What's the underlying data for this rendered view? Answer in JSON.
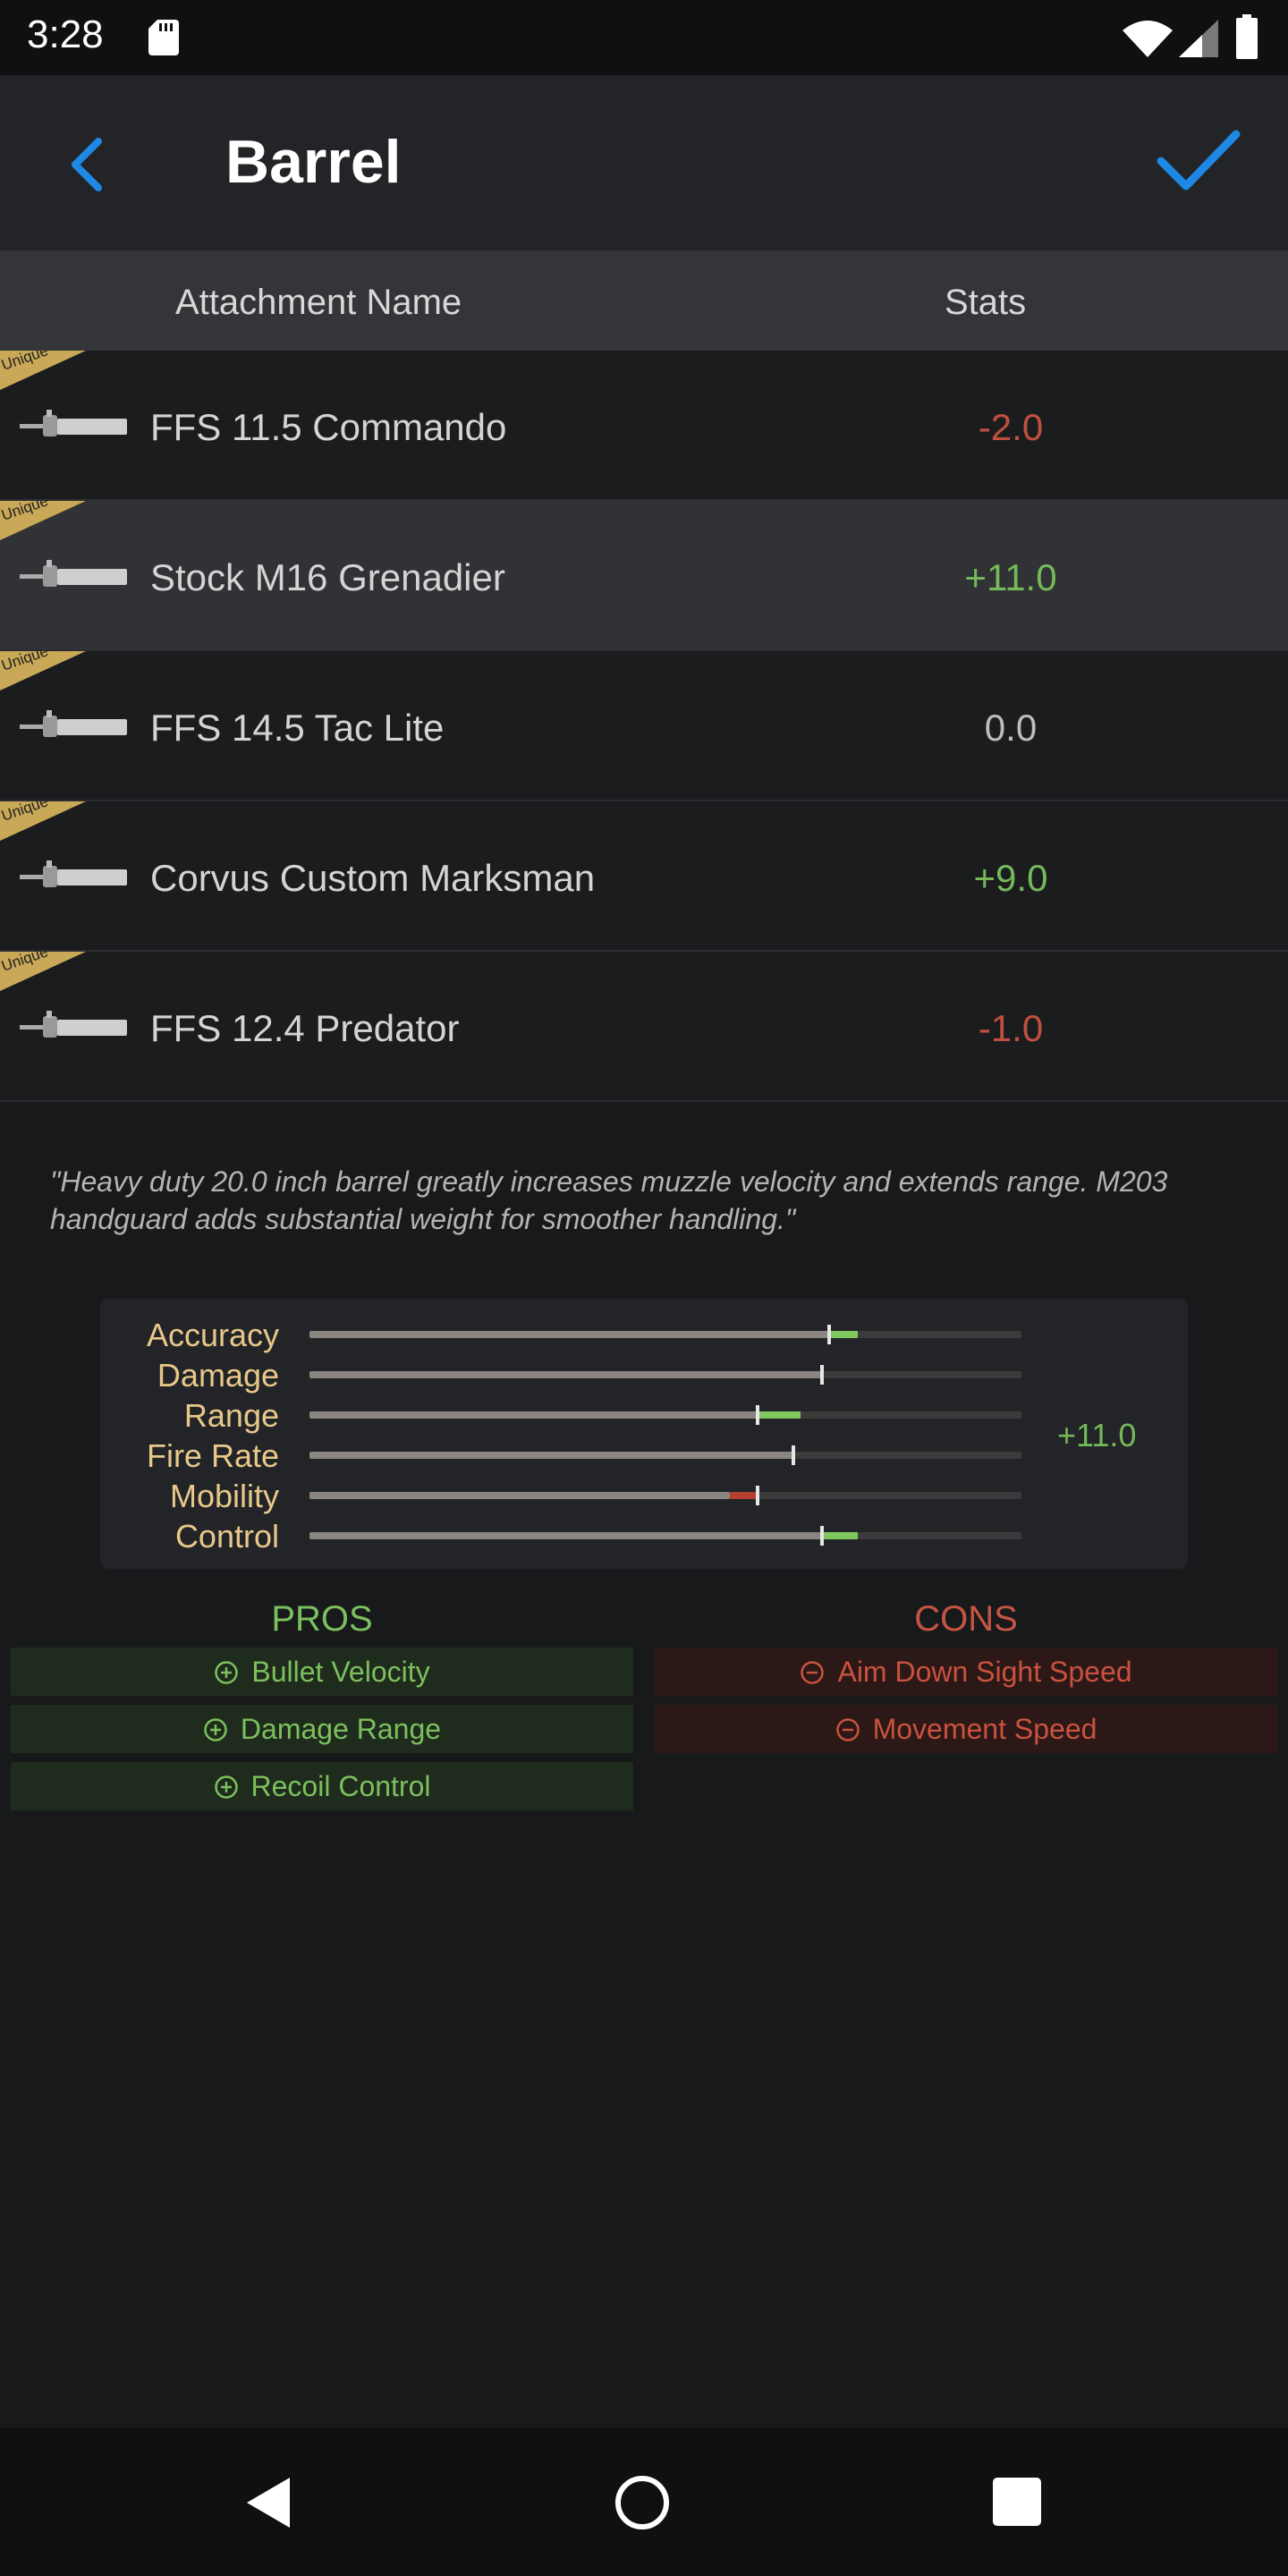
{
  "status_bar": {
    "time": "3:28"
  },
  "header": {
    "title": "Barrel"
  },
  "table": {
    "col_name": "Attachment Name",
    "col_stats": "Stats",
    "ribbon_label": "Unique",
    "rows": [
      {
        "name": "FFS 11.5 Commando",
        "stat": "-2.0",
        "tone": "neg",
        "selected": false
      },
      {
        "name": "Stock M16 Grenadier",
        "stat": "+11.0",
        "tone": "pos",
        "selected": true
      },
      {
        "name": "FFS 14.5 Tac Lite",
        "stat": "0.0",
        "tone": "neu",
        "selected": false
      },
      {
        "name": "Corvus Custom Marksman",
        "stat": "+9.0",
        "tone": "pos",
        "selected": false
      },
      {
        "name": "FFS 12.4 Predator",
        "stat": "-1.0",
        "tone": "neg",
        "selected": false
      }
    ]
  },
  "description": "\"Heavy duty 20.0 inch barrel greatly increases muzzle velocity and extends range. M203 handguard adds substantial weight for smoother handling.\"",
  "stats": {
    "total": "+11.0",
    "items": [
      {
        "label": "Accuracy",
        "base": 0.73,
        "delta": 0.04
      },
      {
        "label": "Damage",
        "base": 0.72,
        "delta": 0.0
      },
      {
        "label": "Range",
        "base": 0.63,
        "delta": 0.06
      },
      {
        "label": "Fire Rate",
        "base": 0.68,
        "delta": 0.0
      },
      {
        "label": "Mobility",
        "base": 0.63,
        "delta": -0.04
      },
      {
        "label": "Control",
        "base": 0.72,
        "delta": 0.05
      }
    ]
  },
  "pros": {
    "title": "PROS",
    "items": [
      "Bullet Velocity",
      "Damage Range",
      "Recoil Control"
    ]
  },
  "cons": {
    "title": "CONS",
    "items": [
      "Aim Down Sight Speed",
      "Movement Speed"
    ]
  },
  "colors": {
    "positive": "#75b95a",
    "negative": "#c0503d",
    "accent": "#1e88e5",
    "label": "#e8c88a",
    "ribbon": "#c9a857"
  },
  "icons": {
    "back": "chevron-left-icon",
    "confirm": "checkmark-icon",
    "pro": "plus-circle-icon",
    "con": "minus-circle-icon"
  }
}
